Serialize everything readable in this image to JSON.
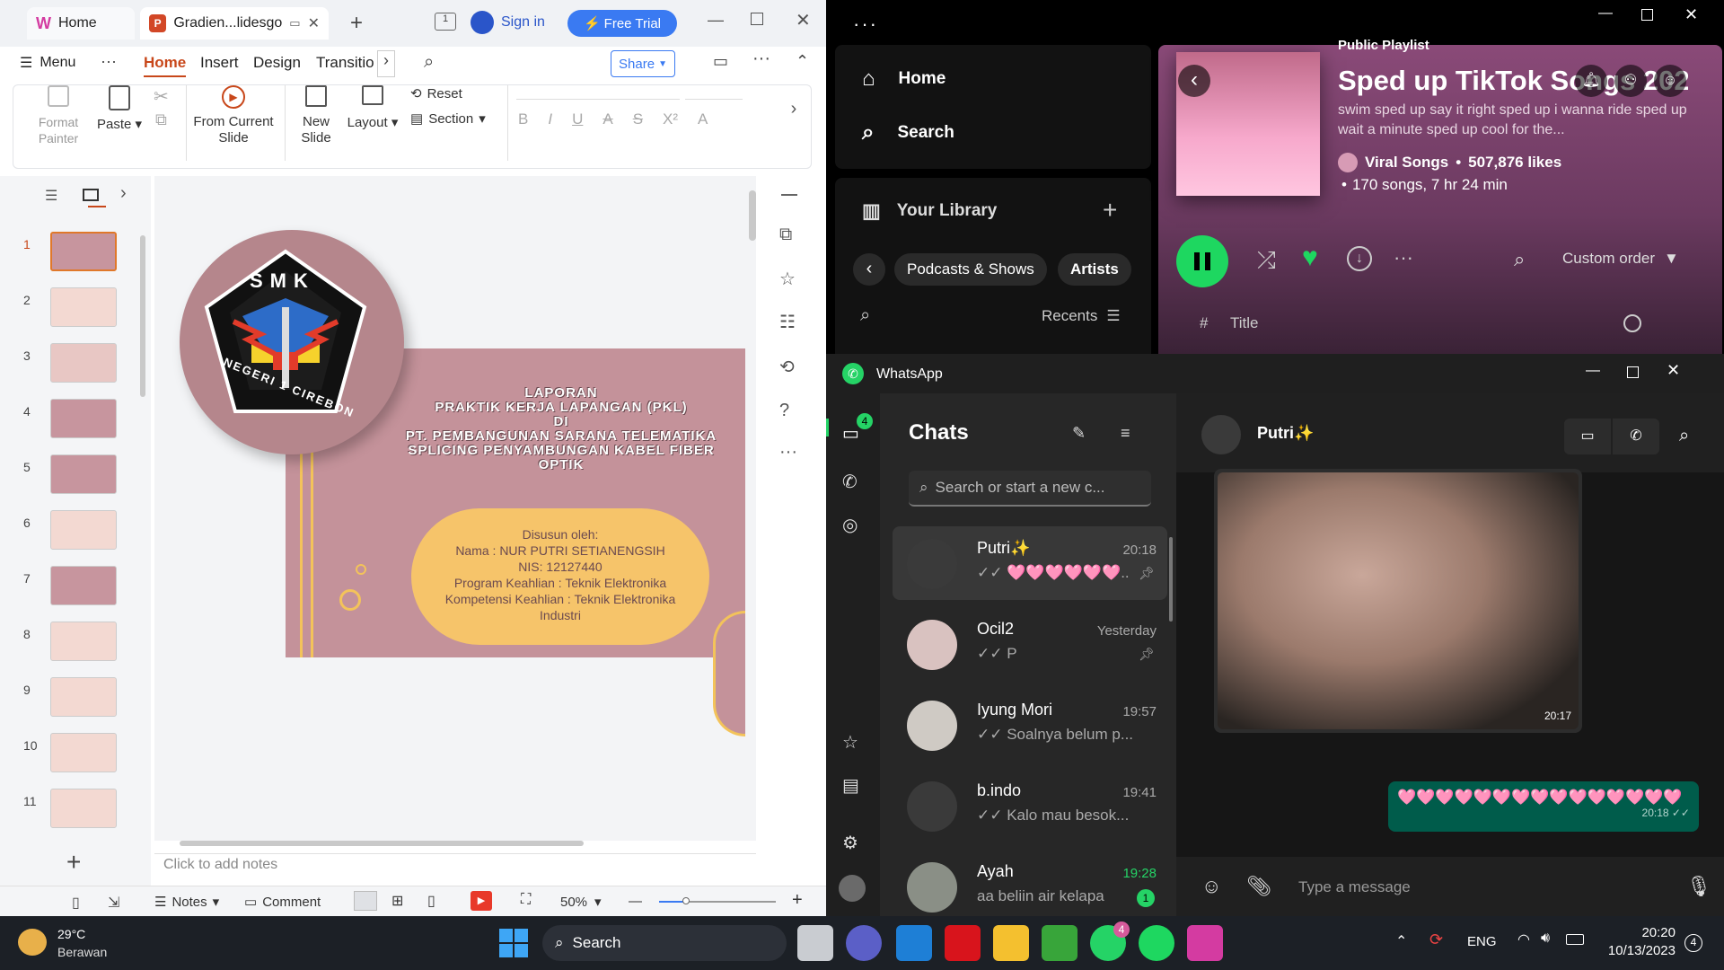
{
  "wps": {
    "tabs": [
      {
        "label": "Home"
      },
      {
        "label": "Gradien...lidesgo"
      }
    ],
    "sign_in": "Sign in",
    "free_trial": "Free Trial",
    "menu": "Menu",
    "menu_tabs": [
      "Home",
      "Insert",
      "Design",
      "Transitio"
    ],
    "share": "Share",
    "ribbon": {
      "format_painter": "Format Painter",
      "paste": "Paste",
      "from_current_slide": "From Current Slide",
      "new_slide": "New Slide",
      "layout": "Layout",
      "reset": "Reset",
      "section": "Section"
    },
    "slide_numbers": [
      "1",
      "2",
      "3",
      "4",
      "5",
      "6",
      "7",
      "8",
      "9",
      "10",
      "11"
    ],
    "slide": {
      "logo_top": "SMK",
      "logo_bottom": "NEGERI 1 CIREBON",
      "title_lines": [
        "LAPORAN",
        "PRAKTIK KERJA LAPANGAN (PKL)",
        "DI",
        "PT. PEMBANGUNAN SARANA TELEMATIKA",
        "SPLICING PENYAMBUNGAN KABEL FIBER",
        "OPTIK"
      ],
      "info_lines": [
        "Disusun oleh:",
        "Nama : NUR PUTRI SETIANENGSIH",
        "NIS: 12127440",
        "Program Keahlian : Teknik Elektronika",
        "Kompetensi Keahlian : Teknik Elektronika",
        "Industri"
      ]
    },
    "notes_placeholder": "Click to add notes",
    "status": {
      "notes": "Notes",
      "comment": "Comment",
      "zoom": "50%"
    }
  },
  "spotify": {
    "nav": {
      "home": "Home",
      "search": "Search"
    },
    "library": "Your Library",
    "filters": [
      "Podcasts & Shows",
      "Artists"
    ],
    "recents": "Recents",
    "playlist": {
      "type": "Public Playlist",
      "title": "Sped up TikTok Songs 2023",
      "description": "swim sped up say it right sped up i wanna ride sped up wait a minute sped up cool for the...",
      "owner": "Viral Songs",
      "likes": "507,876 likes",
      "songs": "170 songs, 7 hr 24 min"
    },
    "sort": "Custom order",
    "col_hash": "#",
    "col_title": "Title",
    "accent": "#1ed760"
  },
  "whatsapp": {
    "app_title": "WhatsApp",
    "chats_title": "Chats",
    "badge": "4",
    "search_placeholder": "Search or start a new c...",
    "chats": [
      {
        "name": "Putri✨",
        "time": "20:18",
        "msg": "✓✓ 🩷🩷🩷🩷🩷🩷..."
      },
      {
        "name": "Ocil2",
        "time": "Yesterday",
        "msg": "✓✓ P"
      },
      {
        "name": "Iyung Mori",
        "time": "19:57",
        "msg": "✓✓ Soalnya belum p..."
      },
      {
        "name": "b.indo",
        "time": "19:41",
        "msg": "✓✓ Kalo mau besok..."
      },
      {
        "name": "Ayah",
        "time": "19:28",
        "msg": "aa beliin air kelapa",
        "unread": "1"
      }
    ],
    "active_chat": "Putri✨",
    "image_time": "20:17",
    "sent_msg": "🩷🩷🩷🩷🩷🩷🩷🩷🩷🩷🩷🩷🩷🩷🩷",
    "sent_time": "20:18 ✓✓",
    "input_placeholder": "Type a message",
    "accent": "#005c4b"
  },
  "taskbar": {
    "weather_temp": "29°C",
    "weather_text": "Berawan",
    "search": "Search",
    "lang": "ENG",
    "time": "20:20",
    "date": "10/13/2023",
    "notif": "4",
    "wa_badge": "4"
  }
}
